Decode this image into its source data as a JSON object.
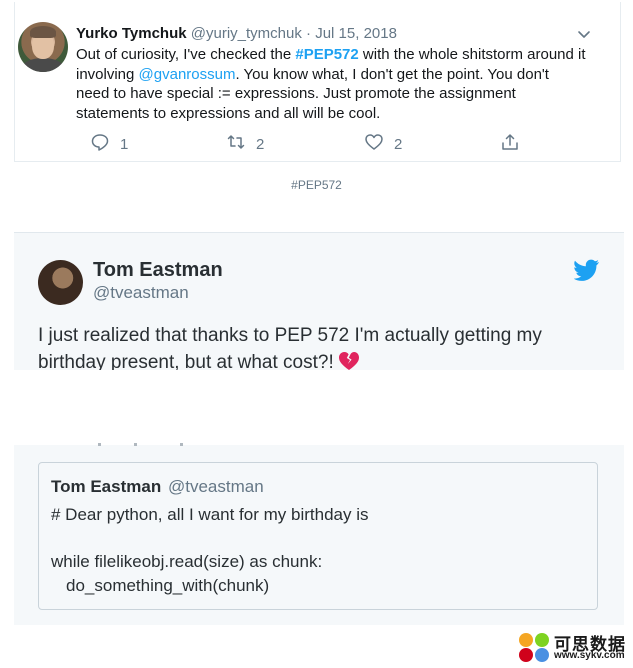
{
  "tweet1": {
    "name": "Yurko Tymchuk",
    "handle": "@yuriy_tymchuk",
    "separator": " · ",
    "date": "Jul 15, 2018",
    "text_parts": {
      "p1": "Out of curiosity, I've checked the ",
      "hashtag": "#PEP572",
      "p2": " with the whole shitstorm around it involving ",
      "mention": "@gvanrossum",
      "p3": ". You know what, I don't get the point. You don't need to have special := expressions. Just promote the assignment statements to expressions and all will be cool."
    },
    "actions": {
      "reply_count": "1",
      "retweet_count": "2",
      "like_count": "2"
    }
  },
  "hashtag_caption": "#PEP572",
  "tweet2": {
    "name": "Tom Eastman",
    "handle": "@tveastman",
    "text": "I just realized that thanks to PEP 572 I'm actually getting my birthday present, but at what cost?!",
    "quoted": {
      "name": "Tom Eastman",
      "handle": "@tveastman",
      "line1": "# Dear python, all I want for my birthday is",
      "line2": "while filelikeobj.read(size) as chunk:",
      "line3": "do_something_with(chunk)"
    }
  },
  "watermark": {
    "text": "可思数据",
    "url": "www.sykv.com"
  },
  "colors": {
    "link": "#1da1f2",
    "muted": "#657786",
    "heart": "#e0245e"
  }
}
